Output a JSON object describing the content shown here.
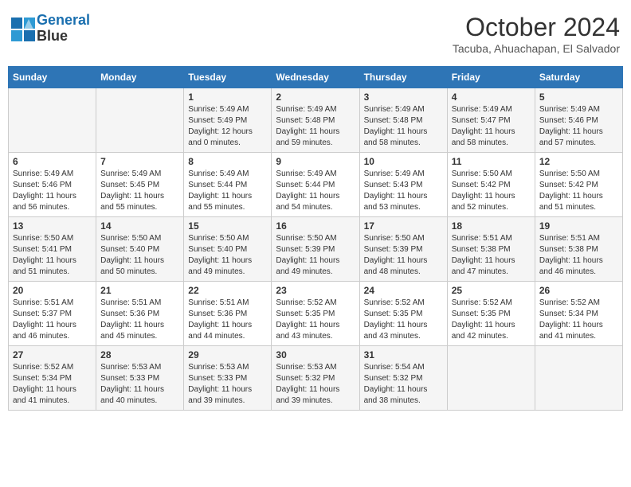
{
  "header": {
    "logo_line1": "General",
    "logo_line2": "Blue",
    "month": "October 2024",
    "location": "Tacuba, Ahuachapan, El Salvador"
  },
  "columns": [
    "Sunday",
    "Monday",
    "Tuesday",
    "Wednesday",
    "Thursday",
    "Friday",
    "Saturday"
  ],
  "weeks": [
    [
      {
        "day": "",
        "info": ""
      },
      {
        "day": "",
        "info": ""
      },
      {
        "day": "1",
        "info": "Sunrise: 5:49 AM\nSunset: 5:49 PM\nDaylight: 12 hours\nand 0 minutes."
      },
      {
        "day": "2",
        "info": "Sunrise: 5:49 AM\nSunset: 5:48 PM\nDaylight: 11 hours\nand 59 minutes."
      },
      {
        "day": "3",
        "info": "Sunrise: 5:49 AM\nSunset: 5:48 PM\nDaylight: 11 hours\nand 58 minutes."
      },
      {
        "day": "4",
        "info": "Sunrise: 5:49 AM\nSunset: 5:47 PM\nDaylight: 11 hours\nand 58 minutes."
      },
      {
        "day": "5",
        "info": "Sunrise: 5:49 AM\nSunset: 5:46 PM\nDaylight: 11 hours\nand 57 minutes."
      }
    ],
    [
      {
        "day": "6",
        "info": "Sunrise: 5:49 AM\nSunset: 5:46 PM\nDaylight: 11 hours\nand 56 minutes."
      },
      {
        "day": "7",
        "info": "Sunrise: 5:49 AM\nSunset: 5:45 PM\nDaylight: 11 hours\nand 55 minutes."
      },
      {
        "day": "8",
        "info": "Sunrise: 5:49 AM\nSunset: 5:44 PM\nDaylight: 11 hours\nand 55 minutes."
      },
      {
        "day": "9",
        "info": "Sunrise: 5:49 AM\nSunset: 5:44 PM\nDaylight: 11 hours\nand 54 minutes."
      },
      {
        "day": "10",
        "info": "Sunrise: 5:49 AM\nSunset: 5:43 PM\nDaylight: 11 hours\nand 53 minutes."
      },
      {
        "day": "11",
        "info": "Sunrise: 5:50 AM\nSunset: 5:42 PM\nDaylight: 11 hours\nand 52 minutes."
      },
      {
        "day": "12",
        "info": "Sunrise: 5:50 AM\nSunset: 5:42 PM\nDaylight: 11 hours\nand 51 minutes."
      }
    ],
    [
      {
        "day": "13",
        "info": "Sunrise: 5:50 AM\nSunset: 5:41 PM\nDaylight: 11 hours\nand 51 minutes."
      },
      {
        "day": "14",
        "info": "Sunrise: 5:50 AM\nSunset: 5:40 PM\nDaylight: 11 hours\nand 50 minutes."
      },
      {
        "day": "15",
        "info": "Sunrise: 5:50 AM\nSunset: 5:40 PM\nDaylight: 11 hours\nand 49 minutes."
      },
      {
        "day": "16",
        "info": "Sunrise: 5:50 AM\nSunset: 5:39 PM\nDaylight: 11 hours\nand 49 minutes."
      },
      {
        "day": "17",
        "info": "Sunrise: 5:50 AM\nSunset: 5:39 PM\nDaylight: 11 hours\nand 48 minutes."
      },
      {
        "day": "18",
        "info": "Sunrise: 5:51 AM\nSunset: 5:38 PM\nDaylight: 11 hours\nand 47 minutes."
      },
      {
        "day": "19",
        "info": "Sunrise: 5:51 AM\nSunset: 5:38 PM\nDaylight: 11 hours\nand 46 minutes."
      }
    ],
    [
      {
        "day": "20",
        "info": "Sunrise: 5:51 AM\nSunset: 5:37 PM\nDaylight: 11 hours\nand 46 minutes."
      },
      {
        "day": "21",
        "info": "Sunrise: 5:51 AM\nSunset: 5:36 PM\nDaylight: 11 hours\nand 45 minutes."
      },
      {
        "day": "22",
        "info": "Sunrise: 5:51 AM\nSunset: 5:36 PM\nDaylight: 11 hours\nand 44 minutes."
      },
      {
        "day": "23",
        "info": "Sunrise: 5:52 AM\nSunset: 5:35 PM\nDaylight: 11 hours\nand 43 minutes."
      },
      {
        "day": "24",
        "info": "Sunrise: 5:52 AM\nSunset: 5:35 PM\nDaylight: 11 hours\nand 43 minutes."
      },
      {
        "day": "25",
        "info": "Sunrise: 5:52 AM\nSunset: 5:35 PM\nDaylight: 11 hours\nand 42 minutes."
      },
      {
        "day": "26",
        "info": "Sunrise: 5:52 AM\nSunset: 5:34 PM\nDaylight: 11 hours\nand 41 minutes."
      }
    ],
    [
      {
        "day": "27",
        "info": "Sunrise: 5:52 AM\nSunset: 5:34 PM\nDaylight: 11 hours\nand 41 minutes."
      },
      {
        "day": "28",
        "info": "Sunrise: 5:53 AM\nSunset: 5:33 PM\nDaylight: 11 hours\nand 40 minutes."
      },
      {
        "day": "29",
        "info": "Sunrise: 5:53 AM\nSunset: 5:33 PM\nDaylight: 11 hours\nand 39 minutes."
      },
      {
        "day": "30",
        "info": "Sunrise: 5:53 AM\nSunset: 5:32 PM\nDaylight: 11 hours\nand 39 minutes."
      },
      {
        "day": "31",
        "info": "Sunrise: 5:54 AM\nSunset: 5:32 PM\nDaylight: 11 hours\nand 38 minutes."
      },
      {
        "day": "",
        "info": ""
      },
      {
        "day": "",
        "info": ""
      }
    ]
  ]
}
